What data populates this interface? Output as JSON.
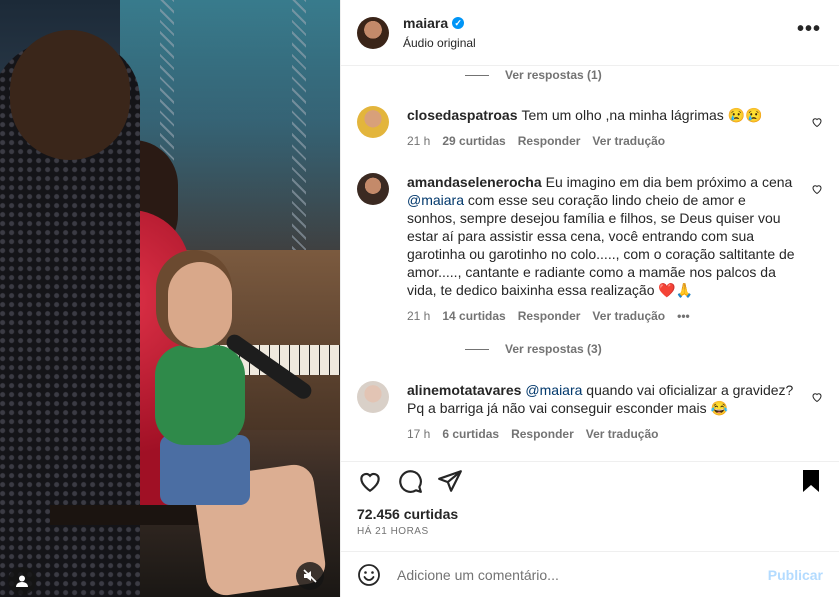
{
  "post": {
    "username": "maiara",
    "audio": "Áudio original",
    "more_label": "•••"
  },
  "comments": [
    {
      "id": "replies1",
      "type": "view_replies",
      "label": "Ver respostas (1)"
    },
    {
      "username": "closedaspatroas",
      "text": "Tem um olho ,na minha lágrimas 😢😢",
      "time": "21 h",
      "likes": "29 curtidas",
      "reply": "Responder",
      "translate": "Ver tradução"
    },
    {
      "username": "amandaselenerocha",
      "text_before": "Eu imagino em dia bem próximo a cena ",
      "mention": "@maiara",
      "text_after": " com esse seu coração lindo cheio de amor e sonhos, sempre desejou família e filhos, se Deus quiser vou estar aí para assistir essa cena, você entrando com sua garotinha ou garotinho no colo....., com o coração saltitante de amor....., cantante e radiante como a mamãe nos palcos da vida, te dedico baixinha essa realização ❤️🙏",
      "time": "21 h",
      "likes": "14 curtidas",
      "reply": "Responder",
      "translate": "Ver tradução",
      "more": "•••"
    },
    {
      "id": "replies2",
      "type": "view_replies",
      "label": "Ver respostas (3)"
    },
    {
      "username": "alinemotatavares",
      "mention": "@maiara",
      "text_after": " quando vai oficializar a gravidez? Pq a barriga já não vai conseguir esconder mais 😂",
      "time": "17 h",
      "likes": "6 curtidas",
      "reply": "Responder",
      "translate": "Ver tradução"
    }
  ],
  "stats": {
    "likes": "72.456 curtidas",
    "time_ago": "HÁ 21 HORAS"
  },
  "composer": {
    "placeholder": "Adicione um comentário...",
    "publish": "Publicar"
  },
  "icons": {
    "verified": "verified-badge",
    "like": "heart-icon",
    "comment": "comment-icon",
    "share": "send-icon",
    "save": "bookmark-icon",
    "emoji": "emoji-icon",
    "tag": "user-tag-icon",
    "mute": "mute-icon"
  },
  "colors": {
    "accent": "#0095f6",
    "publish_disabled": "#b3dbff",
    "heart_emoji": "#e0245e"
  }
}
